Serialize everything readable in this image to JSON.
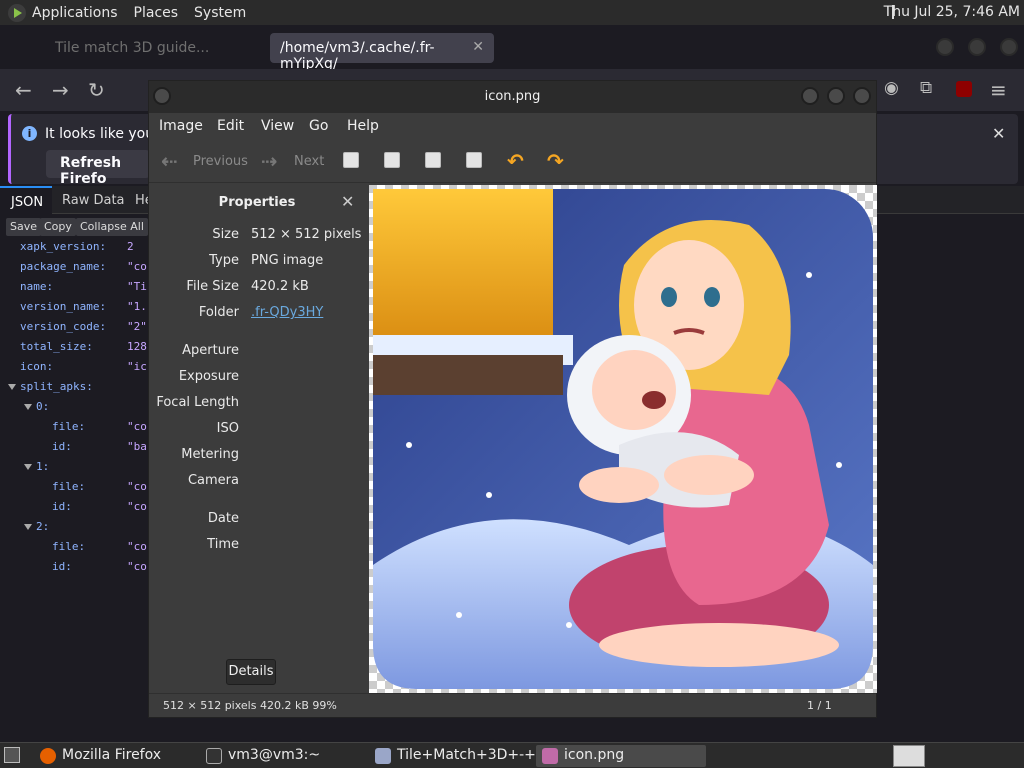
{
  "top_panel": {
    "menus": [
      "Applications",
      "Places",
      "System"
    ],
    "clock": "Thu Jul 25,  7:46 AM"
  },
  "firefox": {
    "tabs": [
      {
        "label": "Tile match 3D guide..."
      },
      {
        "label": "/home/vm3/.cache/.fr-mYipXg/"
      }
    ],
    "notice_text": "It looks like you ha",
    "refresh_label": "Refresh Firefo",
    "json_tabs": [
      "JSON",
      "Raw Data",
      "He"
    ],
    "json_toolbar": [
      "Save",
      "Copy",
      "Collapse All"
    ],
    "json_rows": [
      {
        "key": "xapk_version:",
        "val": "2",
        "indent": 0
      },
      {
        "key": "package_name:",
        "val": "\"co",
        "indent": 0
      },
      {
        "key": "name:",
        "val": "\"Ti",
        "indent": 0
      },
      {
        "key": "version_name:",
        "val": "\"1.",
        "indent": 0
      },
      {
        "key": "version_code:",
        "val": "\"2\"",
        "indent": 0
      },
      {
        "key": "total_size:",
        "val": "128",
        "indent": 0
      },
      {
        "key": "icon:",
        "val": "\"ic",
        "indent": 0
      },
      {
        "key": "split_apks:",
        "val": "",
        "indent": 0,
        "twisty": true
      },
      {
        "key": "0:",
        "val": "",
        "indent": 1,
        "twisty": true
      },
      {
        "key": "file:",
        "val": "\"co",
        "indent": 2
      },
      {
        "key": "id:",
        "val": "\"ba",
        "indent": 2
      },
      {
        "key": "1:",
        "val": "",
        "indent": 1,
        "twisty": true
      },
      {
        "key": "file:",
        "val": "\"co",
        "indent": 2
      },
      {
        "key": "id:",
        "val": "\"co",
        "indent": 2
      },
      {
        "key": "2:",
        "val": "",
        "indent": 1,
        "twisty": true
      },
      {
        "key": "file:",
        "val": "\"co",
        "indent": 2
      },
      {
        "key": "id:",
        "val": "\"co",
        "indent": 2
      }
    ]
  },
  "viewer": {
    "title": "icon.png",
    "menus": [
      "Image",
      "Edit",
      "View",
      "Go",
      "Help"
    ],
    "toolbar": {
      "previous": "Previous",
      "next": "Next"
    },
    "props_title": "Properties",
    "props": [
      {
        "label": "Size",
        "value": "512 × 512 pixels"
      },
      {
        "label": "Type",
        "value": "PNG image"
      },
      {
        "label": "File Size",
        "value": "420.2 kB"
      },
      {
        "label": "Folder",
        "value": ".fr-QDy3HY"
      },
      {
        "label": "Aperture",
        "value": ""
      },
      {
        "label": "Exposure",
        "value": ""
      },
      {
        "label": "Focal Length",
        "value": ""
      },
      {
        "label": "ISO",
        "value": ""
      },
      {
        "label": "Metering",
        "value": ""
      },
      {
        "label": "Camera",
        "value": ""
      },
      {
        "label": "Date",
        "value": ""
      },
      {
        "label": "Time",
        "value": ""
      }
    ],
    "details_label": "Details",
    "status_left": "512 × 512 pixels  420.2 kB   99%",
    "status_right": "1 / 1"
  },
  "taskbar": {
    "items": [
      "Mozilla Firefox",
      "vm3@vm3:~",
      "Tile+Match+3D+-+...",
      "icon.png"
    ]
  },
  "colors": {
    "accent": "#2a8ef5",
    "link": "#6aa9de",
    "arrow_orange": "#f5a623"
  }
}
